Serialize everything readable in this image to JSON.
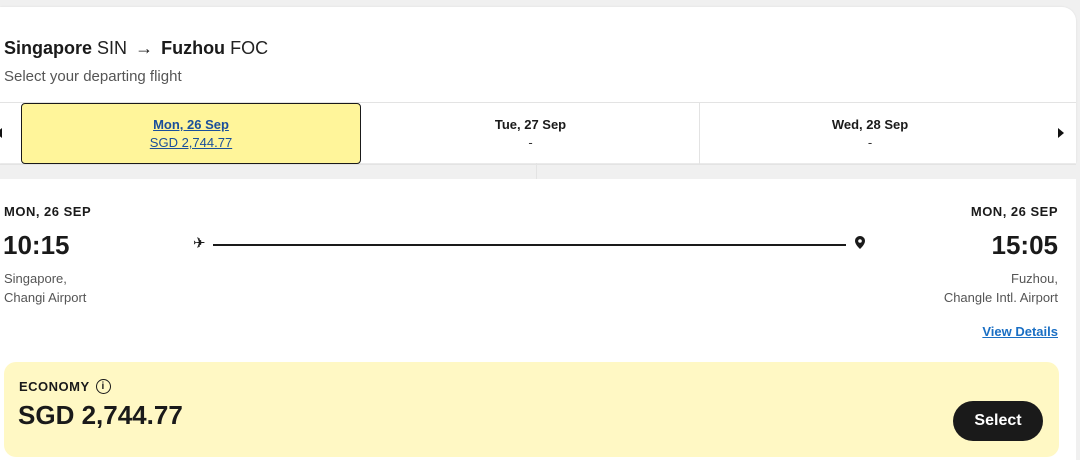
{
  "header": {
    "origin_city": "Singapore",
    "origin_code": "SIN",
    "arrow": "→",
    "dest_city": "Fuzhou",
    "dest_code": "FOC",
    "subtitle": "Select your departing flight"
  },
  "date_tabs": [
    {
      "date": "Mon, 26 Sep",
      "price": "SGD 2,744.77",
      "selected": true
    },
    {
      "date": "Tue, 27 Sep",
      "price": "-",
      "selected": false
    },
    {
      "date": "Wed, 28 Sep",
      "price": "-",
      "selected": false
    }
  ],
  "flight": {
    "departure": {
      "date": "MON, 26 SEP",
      "time": "10:15",
      "place_line1": "Singapore,",
      "place_line2": "Changi Airport"
    },
    "arrival": {
      "date": "MON, 26 SEP",
      "time": "15:05",
      "place_line1": "Fuzhou,",
      "place_line2": "Changle Intl. Airport"
    },
    "view_details": "View Details"
  },
  "fare": {
    "class": "ECONOMY",
    "info_icon": "i",
    "price": "SGD 2,744.77",
    "select_label": "Select"
  },
  "colors": {
    "selected_tab_bg": "#fff59a",
    "fare_bg": "#fff8c4",
    "link": "#1a6fc4",
    "button": "#1a1a1a"
  }
}
